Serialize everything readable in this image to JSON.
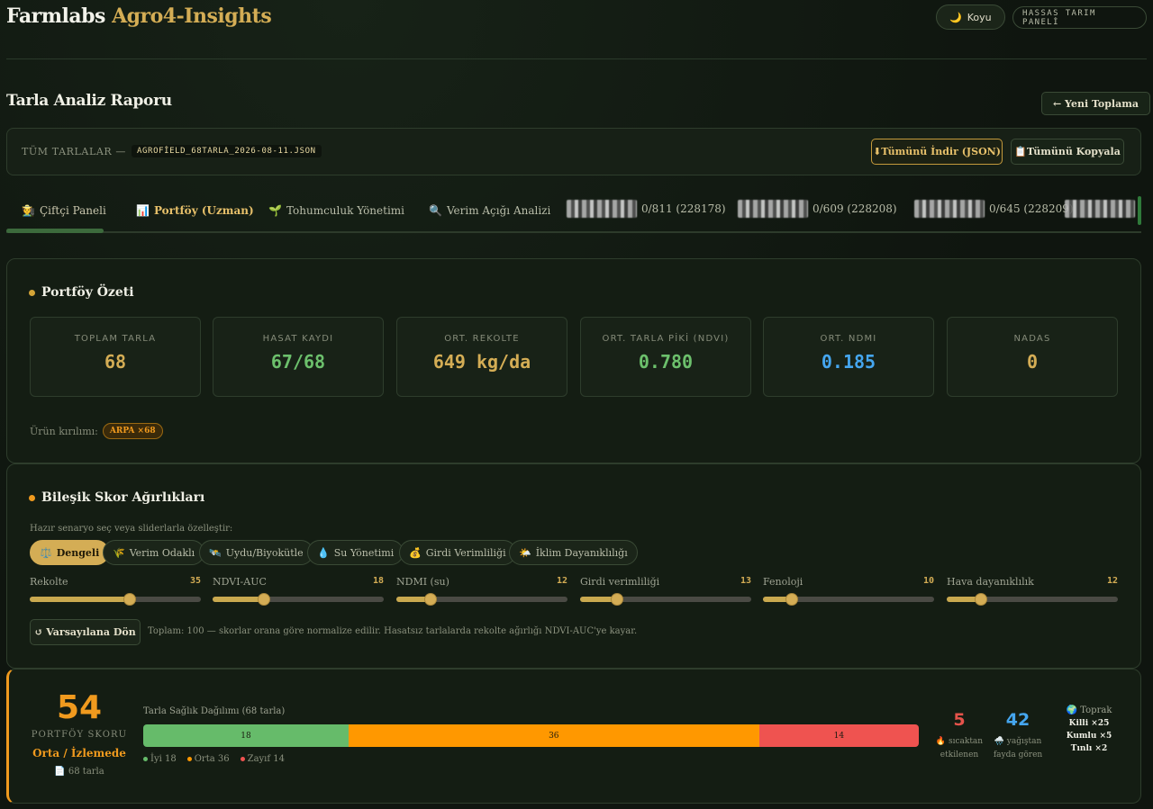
{
  "header": {
    "brand_primary": "Farmlabs",
    "brand_secondary": "Agro4-Insights",
    "theme_label": "Koyu",
    "panel_badge": "HASSAS TARIM PANELİ"
  },
  "page": {
    "title": "Tarla Analiz Raporu",
    "new_button": "← Yeni Toplama"
  },
  "file_bar": {
    "label": "TÜM TARLALAR —",
    "filename": "AGROFİELD_68TARLA_2026-08-11.JSON",
    "download_label": "Tümünü İndir (JSON)",
    "copy_label": "Tümünü Kopyala"
  },
  "tabs": [
    {
      "icon": "🧑‍🌾",
      "label": "Çiftçi Paneli"
    },
    {
      "icon": "📊",
      "label": "Portföy (Uzman)"
    },
    {
      "icon": "🌱",
      "label": "Tohumculuk Yönetimi"
    },
    {
      "icon": "🔍",
      "label": "Verim Açığı Analizi"
    },
    {
      "label": "0/811 (228178)"
    },
    {
      "label": "0/609 (228208)"
    },
    {
      "label": "0/645 (228209)"
    }
  ],
  "portfolio": {
    "title": "Portföy Özeti",
    "stats": [
      {
        "key": "TOPLAM TARLA",
        "value": "68"
      },
      {
        "key": "HASAT KAYDI",
        "value": "67/68"
      },
      {
        "key": "ORT. REKOLTE",
        "value": "649 kg/da"
      },
      {
        "key": "ORT. TARLA PİKİ (NDVI)",
        "value": "0.780"
      },
      {
        "key": "ORT. NDMI",
        "value": "0.185"
      },
      {
        "key": "NADAS",
        "value": "0"
      }
    ],
    "crop_label": "Ürün kırılımı:",
    "crop_chip": "ARPA ×68"
  },
  "weights": {
    "title": "Bileşik Skor Ağırlıkları",
    "hint": "Hazır senaryo seç veya sliderlarla özelleştir:",
    "presets": [
      {
        "icon": "⚖️",
        "label": "Dengeli"
      },
      {
        "icon": "🌾",
        "label": "Verim Odaklı"
      },
      {
        "icon": "🛰️",
        "label": "Uydu/Biyokütle"
      },
      {
        "icon": "💧",
        "label": "Su Yönetimi"
      },
      {
        "icon": "💰",
        "label": "Girdi Verimliliği"
      },
      {
        "icon": "🌤️",
        "label": "İklim Dayanıklılığı"
      }
    ],
    "active_preset": "Dengeli",
    "sliders": [
      {
        "label": "Rekolte",
        "value": 35
      },
      {
        "label": "NDVI-AUC",
        "value": 18
      },
      {
        "label": "NDMI (su)",
        "value": 12
      },
      {
        "label": "Girdi verimliliği",
        "value": 13
      },
      {
        "label": "Fenoloji",
        "value": 10
      },
      {
        "label": "Hava dayanıklılık",
        "value": 12
      }
    ],
    "reset_label": "↺ Varsayılana Dön",
    "total_note": "Toplam: 100 — skorlar orana göre normalize edilir. Hasatsız tarlalarda rekolte ağırlığı NDVI-AUC'ye kayar."
  },
  "score": {
    "value": "54",
    "label": "PORTFÖY SKORU",
    "status": "Orta / İzlemede",
    "count": "📄 68 tarla",
    "dist_title": "Tarla Sağlık Dağılımı (68 tarla)",
    "segments": [
      {
        "label": "İyi",
        "value": 18,
        "color": "#66bb6a"
      },
      {
        "label": "Orta",
        "value": 36,
        "color": "#ff9800"
      },
      {
        "label": "Zayıf",
        "value": 14,
        "color": "#ef5350"
      }
    ],
    "legend": [
      "● İyi 18",
      "● Orta 36",
      "● Zayıf 14"
    ],
    "heat_value": "5",
    "heat_label_1": "🔥 sıcaktan",
    "heat_label_2": "etkilenen",
    "rain_value": "42",
    "rain_label_1": "🌧️ yağıştan",
    "rain_label_2": "fayda gören",
    "soil_title": "🌍 Toprak",
    "soil_rows": [
      "Killi ×25",
      "Kumlu ×5",
      "Tınlı ×2"
    ]
  }
}
